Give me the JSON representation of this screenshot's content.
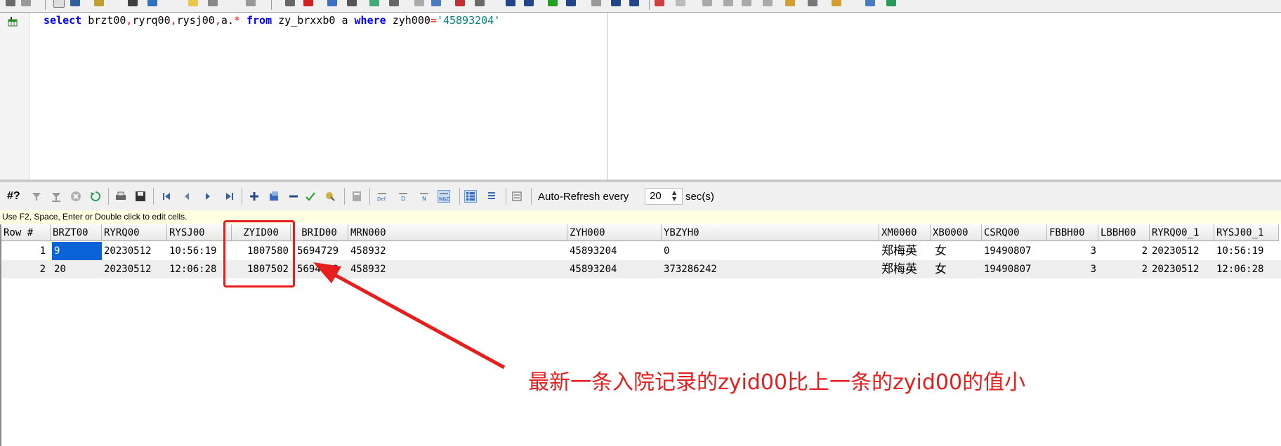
{
  "editor": {
    "sql": {
      "kw_select": "select",
      "cols": " brzt00",
      "c1": ",",
      "col2": "ryrq00",
      "c2": ",",
      "col3": "rysj00",
      "c3": ",",
      "col4": "a.",
      "star": "*",
      "kw_from": " from ",
      "table": "zy_brxxb0 a ",
      "kw_where": "where",
      "cond": " zyh000",
      "eq": "=",
      "value": "'45893204'"
    }
  },
  "grid_toolbar": {
    "rowcount_label": "#?",
    "auto_refresh_label": "Auto-Refresh every",
    "refresh_value": "20",
    "sec_label": "sec(s)"
  },
  "hint": "Use F2, Space, Enter or Double click to edit cells.",
  "columns": [
    "Row #",
    "BRZT00",
    "RYRQ00",
    "RYSJ00",
    "ZYID00",
    "BRID00",
    "MRN000",
    "ZYH000",
    "YBZYH0",
    "XM0000",
    "XB0000",
    "CSRQ00",
    "FBBH00",
    "LBBH00",
    "RYRQ00_1",
    "RYSJ00_1"
  ],
  "rows": [
    {
      "row": "1",
      "brzt00": "9",
      "ryrq00": "20230512",
      "rysj00": "10:56:19",
      "zyid00": "1807580",
      "brid00": "5694729",
      "mrn000": "458932",
      "zyh000": "45893204",
      "ybzyh0": "0",
      "xm0000": "郑梅英",
      "xb0000": "女",
      "csrq00": "19490807",
      "fbbh00": "3",
      "lbbh00": "2",
      "ryrq00_1": "20230512",
      "rysj00_1": "10:56:19"
    },
    {
      "row": "2",
      "brzt00": "20",
      "ryrq00": "20230512",
      "rysj00": "12:06:28",
      "zyid00": "1807502",
      "brid00": "5694729",
      "mrn000": "458932",
      "zyh000": "45893204",
      "ybzyh0": "373286242",
      "xm0000": "郑梅英",
      "xb0000": "女",
      "csrq00": "19490807",
      "fbbh00": "3",
      "lbbh00": "2",
      "ryrq00_1": "20230512",
      "rysj00_1": "12:06:28"
    }
  ],
  "annotation": "最新一条入院记录的zyid00比上一条的zyid00的值小",
  "colors": {
    "annotation": "#e61e1e",
    "selection": "#0a64d8",
    "keyword": "#0000ff",
    "string": "#008080"
  }
}
